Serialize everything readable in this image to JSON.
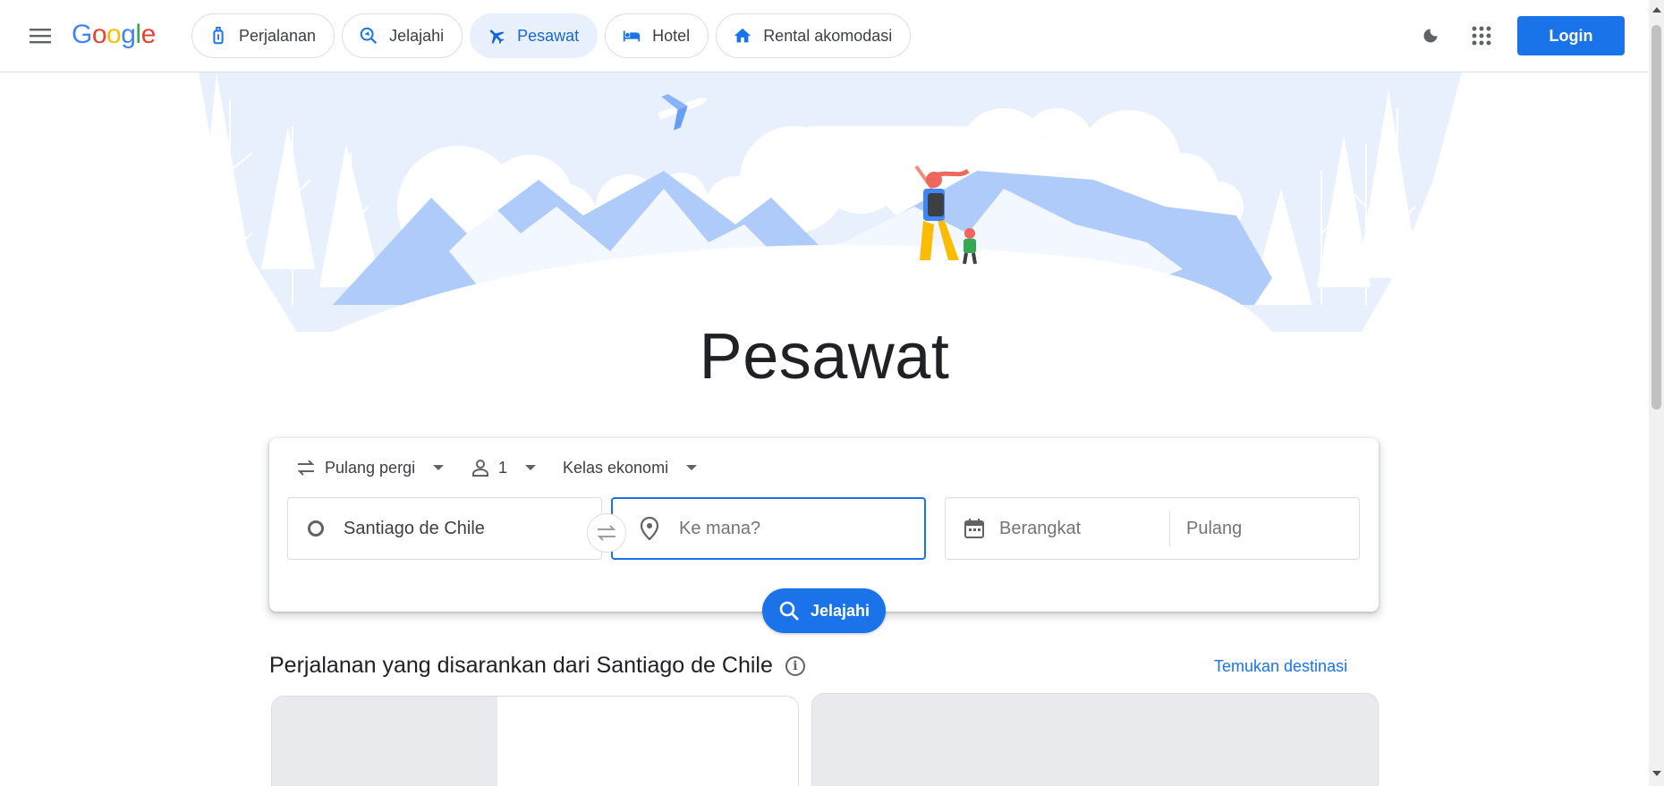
{
  "header": {
    "logo_letters": [
      "G",
      "o",
      "o",
      "g",
      "l",
      "e"
    ],
    "nav": [
      {
        "label": "Perjalanan",
        "icon": "luggage-icon",
        "active": false
      },
      {
        "label": "Jelajahi",
        "icon": "explore-icon",
        "active": false
      },
      {
        "label": "Pesawat",
        "icon": "flight-icon",
        "active": true
      },
      {
        "label": "Hotel",
        "icon": "hotel-icon",
        "active": false
      },
      {
        "label": "Rental akomodasi",
        "icon": "home-icon",
        "active": false
      }
    ],
    "login_label": "Login"
  },
  "hero": {
    "title": "Pesawat"
  },
  "search": {
    "trip_type": "Pulang pergi",
    "passengers": "1",
    "cabin_class": "Kelas ekonomi",
    "origin": "Santiago de Chile",
    "destination_placeholder": "Ke mana?",
    "depart_placeholder": "Berangkat",
    "return_placeholder": "Pulang",
    "explore_label": "Jelajahi"
  },
  "suggestions": {
    "title": "Perjalanan yang disarankan dari Santiago de Chile",
    "find_link": "Temukan destinasi"
  },
  "colors": {
    "accent": "#1a73e8",
    "active_chip_bg": "#e8f0fe",
    "hero_light": "#e8f0fe",
    "hero_mid": "#aecbfa"
  }
}
